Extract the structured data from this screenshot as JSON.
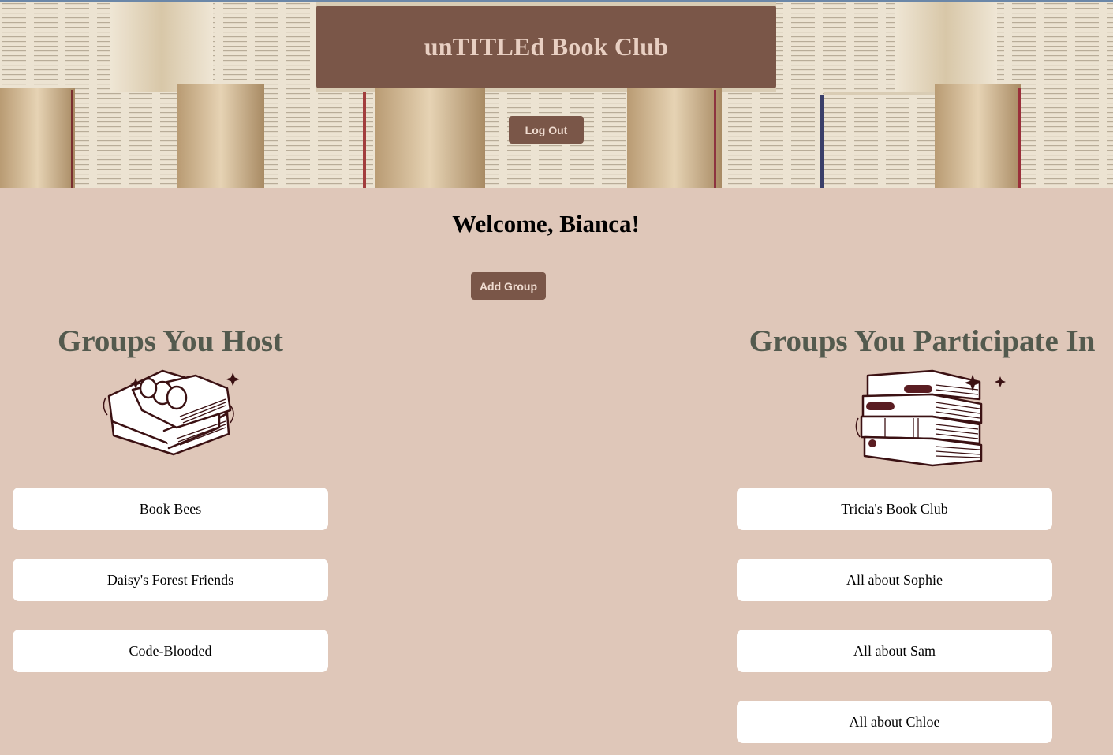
{
  "header": {
    "title": "unTITLEd Book Club",
    "logout_label": "Log Out"
  },
  "welcome": "Welcome, Bianca!",
  "add_group_label": "Add Group",
  "hosted": {
    "title": "Groups You Host",
    "groups": [
      "Book Bees",
      "Daisy's Forest Friends",
      "Code-Blooded"
    ]
  },
  "participating": {
    "title": "Groups You Participate In",
    "groups": [
      "Tricia's Book Club",
      "All about Sophie",
      "All about Sam",
      "All about Chloe"
    ]
  },
  "colors": {
    "page_bg": "#dfc7b9",
    "accent": "#7a5648",
    "heading": "#535a4e",
    "card_bg": "#ffffff"
  }
}
